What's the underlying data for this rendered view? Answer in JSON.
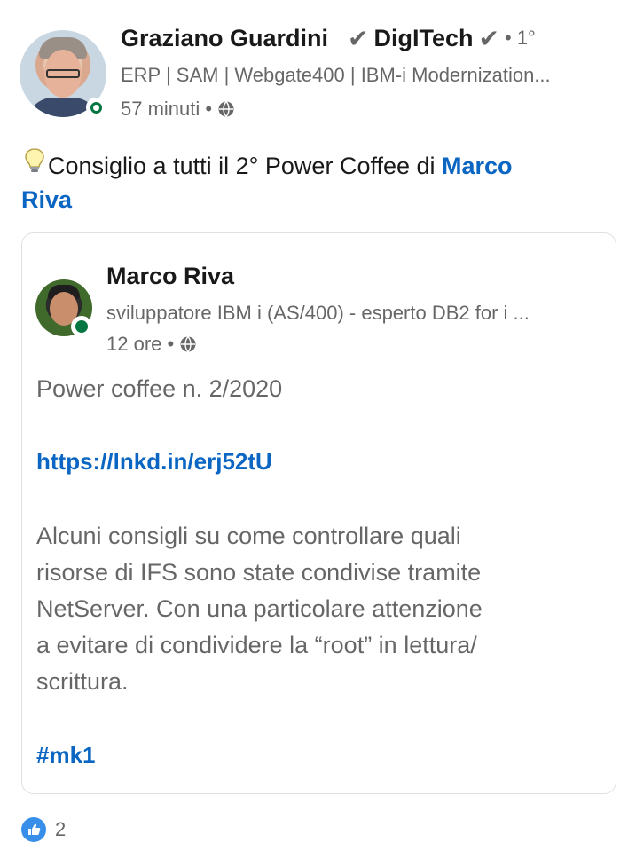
{
  "colors": {
    "link": "#0a66c2",
    "presence": "#057642",
    "like": "#378fe9"
  },
  "post": {
    "author": {
      "name": "Graziano Guardini",
      "badge_text": "DigITech",
      "degree": "• 1°",
      "headline": "ERP | SAM | Webgate400 | IBM-i Modernization...",
      "time": "57 minuti •"
    },
    "text_prefix": "Consiglio a tutti il 2° Power Coffee di ",
    "mention_line1": "Marco",
    "mention_line2": "Riva"
  },
  "shared": {
    "author": {
      "name": "Marco Riva",
      "headline": "sviluppatore IBM i (AS/400) - esperto DB2 for i ...",
      "time": "12 ore •"
    },
    "title": "Power coffee n. 2/2020",
    "link": "https://lnkd.in/erj52tU",
    "body_lines": [
      "Alcuni consigli su come controllare quali",
      "risorse di IFS sono state condivise tramite",
      "NetServer. Con una particolare attenzione",
      "a evitare di condividere la “root” in lettura/",
      "scrittura."
    ],
    "hashtag": "#mk1"
  },
  "reactions": {
    "count": "2"
  },
  "icons": [
    "globe-icon",
    "lightbulb-icon",
    "check-icon",
    "like-icon",
    "presence-icon"
  ]
}
